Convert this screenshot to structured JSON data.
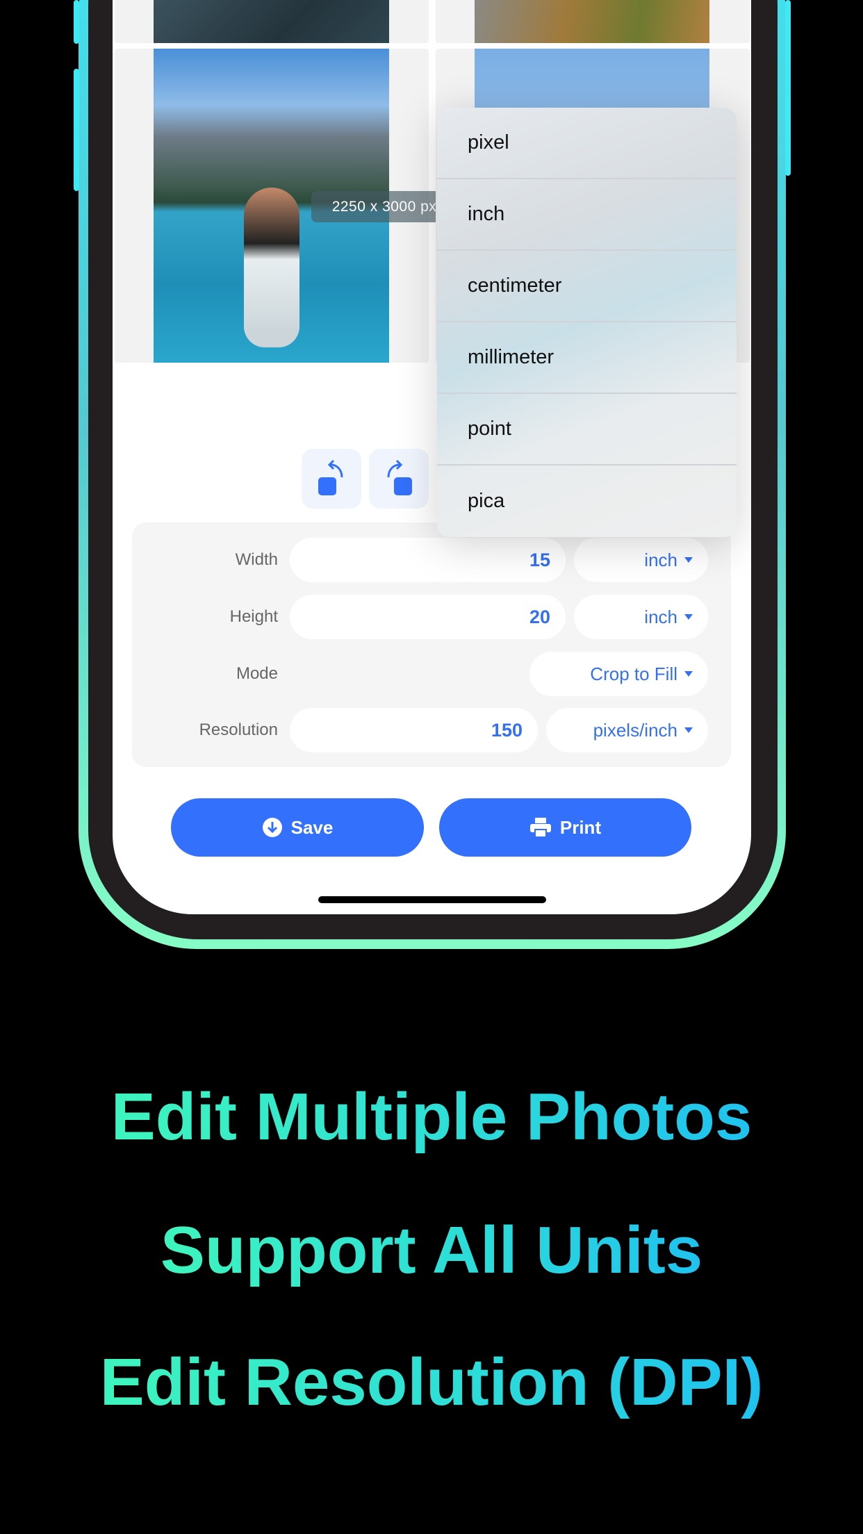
{
  "photos": [
    {
      "badge": ""
    },
    {
      "badge": ""
    },
    {
      "badge": "2250 x 3000 px"
    },
    {
      "badge": ""
    }
  ],
  "unit_menu": {
    "options": [
      "pixel",
      "inch",
      "centimeter",
      "millimeter",
      "point",
      "pica"
    ]
  },
  "settings": {
    "width": {
      "label": "Width",
      "value": "15",
      "unit": "inch"
    },
    "height": {
      "label": "Height",
      "value": "20",
      "unit": "inch"
    },
    "mode": {
      "label": "Mode",
      "value": "Crop to Fill"
    },
    "resolution": {
      "label": "Resolution",
      "value": "150",
      "unit": "pixels/inch"
    }
  },
  "actions": {
    "save": "Save",
    "print": "Print"
  },
  "taglines": [
    "Edit Multiple Photos",
    "Support All Units",
    "Edit Resolution (DPI)"
  ],
  "colors": {
    "accent": "#3370fb",
    "panel": "#f5f5f5",
    "tagline_start": "#3ef5bd",
    "tagline_end": "#1fc2ef"
  }
}
